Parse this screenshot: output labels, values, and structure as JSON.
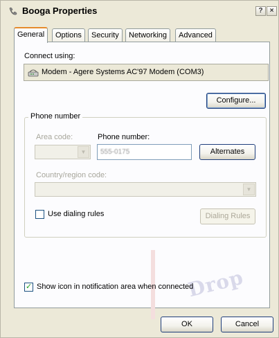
{
  "window": {
    "title": "Booga Properties",
    "help_button": "?",
    "close_button": "×"
  },
  "tabs": [
    {
      "label": "General",
      "active": true
    },
    {
      "label": "Options",
      "active": false
    },
    {
      "label": "Security",
      "active": false
    },
    {
      "label": "Networking",
      "active": false
    },
    {
      "label": "Advanced",
      "active": false
    }
  ],
  "general": {
    "connect_using_label": "Connect using:",
    "modem_name": "Modem - Agere Systems AC'97 Modem (COM3)",
    "configure_button": "Configure...",
    "phone_group_title": "Phone number",
    "area_code_label": "Area code:",
    "area_code_value": "",
    "phone_number_label": "Phone number:",
    "phone_number_value": "555-0175",
    "alternates_button": "Alternates",
    "country_label": "Country/region code:",
    "country_value": "",
    "dialing_rules_label": "Use dialing rules",
    "dialing_rules_checked": false,
    "dialing_rules_button": "Dialing Rules",
    "notify_label": "Show icon in notification area when connected",
    "notify_checked": true
  },
  "footer": {
    "ok_button": "OK",
    "cancel_button": "Cancel"
  },
  "watermark_text": "Drop",
  "colors": {
    "window_bg": "#ece9d8",
    "panel_bg": "#fcfcfe",
    "active_tab_accent": "#e68b2c",
    "button_border": "#1e3d7a",
    "check_green": "#21a121"
  }
}
